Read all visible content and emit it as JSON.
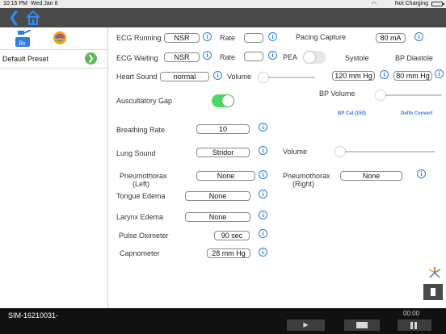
{
  "status_bar": {
    "time": "10:15 PM",
    "date": "Wed Jan 8",
    "charging": "Not Charging"
  },
  "sidebar": {
    "preset_label": "Default Preset"
  },
  "main": {
    "ecg_running_label": "ECG Running",
    "ecg_running_value": "NSR",
    "ecg_running_rate_label": "Rate",
    "ecg_running_rate_value": "",
    "pacing_capture_label": "Pacing Capture",
    "pacing_capture_value": "80 mA",
    "ecg_waiting_label": "ECG Waiting",
    "ecg_waiting_value": "NSR",
    "ecg_waiting_rate_label": "Rate",
    "ecg_waiting_rate_value": "",
    "pea_label": "PEA",
    "pea_on": false,
    "systole_label": "Systole",
    "bp_diastole_label": "BP Diastole",
    "heart_sound_label": "Heart Sound",
    "heart_sound_value": "normal",
    "heart_volume_label": "Volume",
    "heart_volume_level": 0.0,
    "systole_value": "120 mm Hg",
    "diastole_value": "80 mm Hg",
    "bp_volume_label": "BP Volume",
    "bp_volume_level": 0.0,
    "auscultatory_gap_label": "Auscultatory Gap",
    "auscultatory_gap_on": true,
    "bp_cal_link": "BP Cal (150)",
    "defib_convert_link": "Defib Convert",
    "breathing_rate_label": "Breathing Rate",
    "breathing_rate_value": "10",
    "lung_sound_label": "Lung Sound",
    "lung_sound_value": "Stridor",
    "lung_volume_label": "Volume",
    "lung_volume_level": 0.0,
    "pneumo_left_label_1": "Pneumothorax",
    "pneumo_left_label_2": "(Left)",
    "pneumo_left_value": "None",
    "pneumo_right_label_1": "Pneumothorax",
    "pneumo_right_label_2": "(Right)",
    "pneumo_right_value": "None",
    "tongue_edema_label": "Tongue Edema",
    "tongue_edema_value": "None",
    "larynx_edema_label": "Larynx Edema",
    "larynx_edema_value": "None",
    "pulse_oximeter_label": "Pulse Oximeter",
    "pulse_oximeter_value": "90 sec",
    "capnometer_label": "Capnometer",
    "capnometer_value": "28 mm Hg"
  },
  "bottom_bar": {
    "sim_id": "SIM-16210031-",
    "elapsed": "00:00"
  },
  "colors": {
    "accent": "#2f7de1",
    "toggle_on": "#4cd964",
    "nav_bg": "#4a4a4a",
    "bottom_bg": "#111111",
    "preset_go": "#5cb85c"
  },
  "icons": [
    "back-chevron-icon",
    "home-icon",
    "rx-scenario-icon",
    "brain-icon",
    "arrow-right-icon",
    "info-icon",
    "logo-icon",
    "play-icon",
    "stop-icon",
    "pause-icon"
  ]
}
